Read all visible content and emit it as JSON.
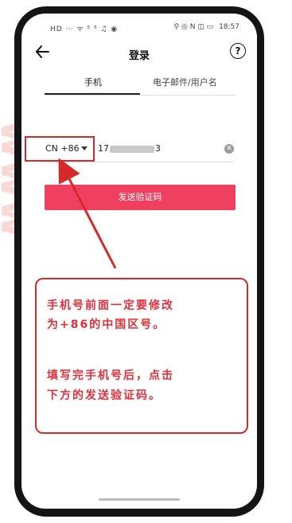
{
  "status_bar": {
    "left_indicators": "HD ⋯ ᯤ ⁵ ⁵ ♫ ◉",
    "right_indicators": "⚲ ◎ N ◫ ▭",
    "time": "18:57"
  },
  "navbar": {
    "title": "登录",
    "help_label": "?"
  },
  "tabs": {
    "phone_label": "手机",
    "email_label": "电子邮件/用户名"
  },
  "phone_input": {
    "country_code": "CN +86",
    "number_prefix": "17",
    "number_suffix": "3"
  },
  "send_button_label": "发送验证码",
  "annotation": {
    "line1": "手机号前面一定要修改",
    "line2": "为+86的中国区号。",
    "line3": "填写完手机号后，点击",
    "line4": "下方的发送验证码。"
  },
  "colors": {
    "accent": "#f0405f",
    "annotation_red": "#d52a2a"
  }
}
